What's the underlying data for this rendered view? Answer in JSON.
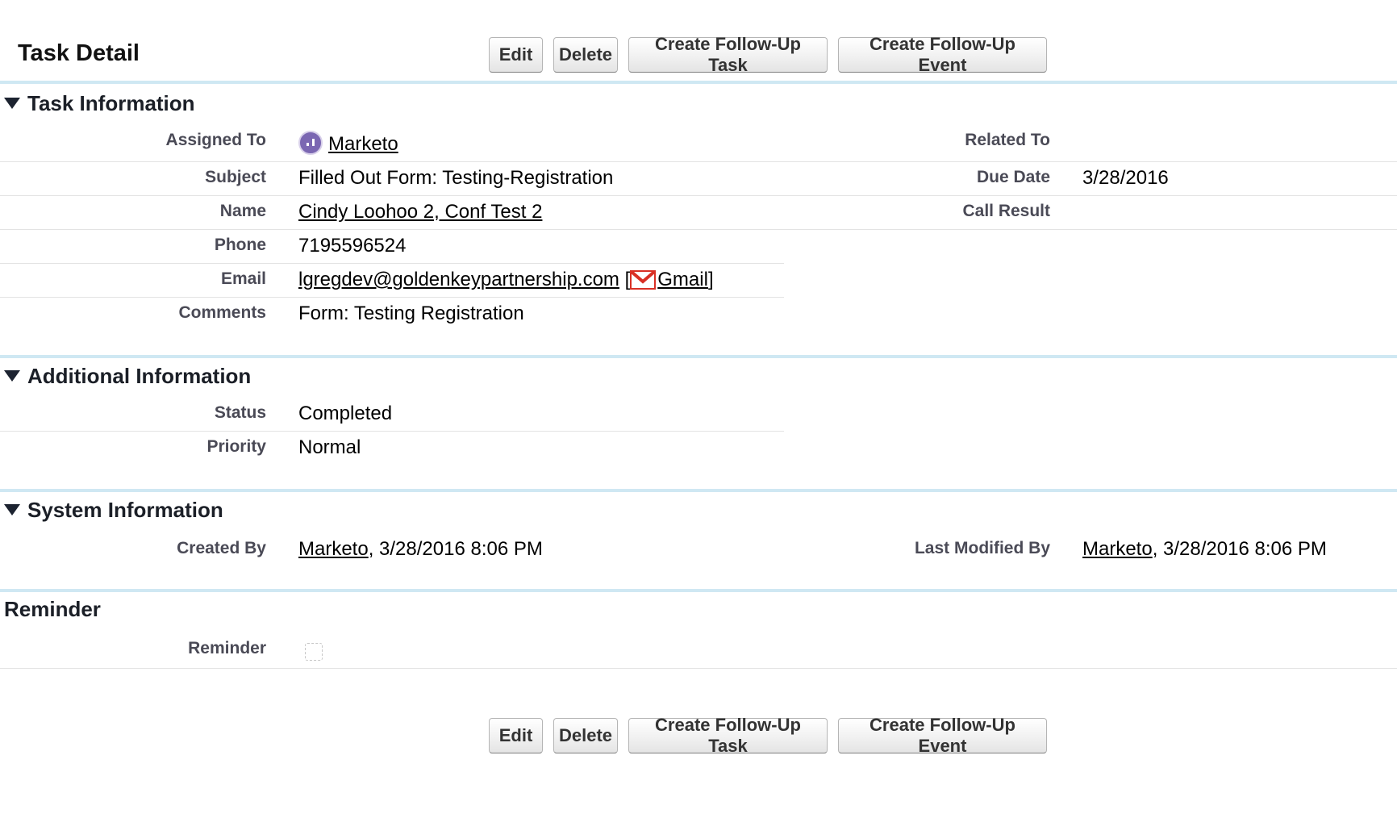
{
  "header": {
    "title": "Task Detail",
    "buttons": {
      "edit": "Edit",
      "delete": "Delete",
      "follow_up_task": "Create Follow-Up Task",
      "follow_up_event": "Create Follow-Up Event"
    }
  },
  "task_information": {
    "title": "Task Information",
    "assigned_to": {
      "label": "Assigned To",
      "value": "Marketo",
      "icon": "marketo-icon"
    },
    "related_to": {
      "label": "Related To",
      "value": ""
    },
    "subject": {
      "label": "Subject",
      "value": "Filled Out Form: Testing-Registration"
    },
    "due_date": {
      "label": "Due Date",
      "value": "3/28/2016"
    },
    "name": {
      "label": "Name",
      "value": "Cindy Loohoo 2, Conf Test 2"
    },
    "call_result": {
      "label": "Call Result",
      "value": ""
    },
    "phone": {
      "label": "Phone",
      "value": "7195596524"
    },
    "email": {
      "label": "Email",
      "value": "lgregdev@goldenkeypartnership.com",
      "bracket_open": "[",
      "gmail_label": "Gmail",
      "bracket_close": "]"
    },
    "comments": {
      "label": "Comments",
      "value": "Form: Testing Registration"
    }
  },
  "additional_information": {
    "title": "Additional Information",
    "status": {
      "label": "Status",
      "value": "Completed"
    },
    "priority": {
      "label": "Priority",
      "value": "Normal"
    }
  },
  "system_information": {
    "title": "System Information",
    "created_by": {
      "label": "Created By",
      "user": "Marketo",
      "timestamp": ", 3/28/2016 8:06 PM"
    },
    "last_modified_by": {
      "label": "Last Modified By",
      "user": "Marketo",
      "timestamp": ", 3/28/2016 8:06 PM"
    }
  },
  "reminder": {
    "title": "Reminder",
    "label": "Reminder",
    "checked": false
  },
  "colors": {
    "section_rule": "#cfe8f3",
    "label": "#4a4a56",
    "marketo_purple": "#7b67b2",
    "gmail_red": "#d93025"
  }
}
